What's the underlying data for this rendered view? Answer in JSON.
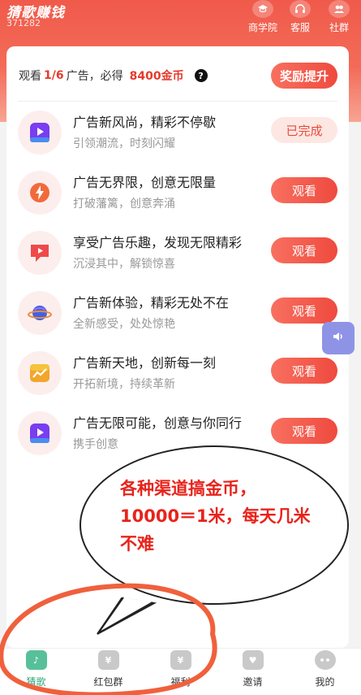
{
  "header": {
    "app_title": "猜歌赚钱",
    "app_id": "371282",
    "buttons": [
      {
        "label": "商学院",
        "icon": "graduation-cap-icon"
      },
      {
        "label": "客服",
        "icon": "headset-icon"
      },
      {
        "label": "社群",
        "icon": "group-icon"
      }
    ]
  },
  "summary": {
    "prefix": "观看",
    "progress": "1/6",
    "middle": "广告，必得",
    "coins": "8400金币",
    "help": "?",
    "reward_button": "奖励提升"
  },
  "tasks": [
    {
      "title": "广告新风尚，精彩不停歇",
      "subtitle": "引领潮流，时刻闪耀",
      "action": "已完成",
      "icon": "play-video-icon",
      "accent": "#7a3df0"
    },
    {
      "title": "广告无界限，创意无限量",
      "subtitle": "打破藩篱，创意奔涌",
      "action": "观看",
      "icon": "lightning-icon",
      "accent": "#f26a3c"
    },
    {
      "title": "享受广告乐趣，发现无限精彩",
      "subtitle": "沉浸其中，解锁惊喜",
      "action": "观看",
      "icon": "video-message-icon",
      "accent": "#ef4a4a"
    },
    {
      "title": "广告新体验，精彩无处不在",
      "subtitle": "全新感受，处处惊艳",
      "action": "观看",
      "icon": "planet-icon",
      "accent": "#3b63e6"
    },
    {
      "title": "广告新天地，创新每一刻",
      "subtitle": "开拓新境，持续革新",
      "action": "观看",
      "icon": "trend-chart-icon",
      "accent": "#f2a62b"
    },
    {
      "title": "广告无限可能，创意与你同行",
      "subtitle": "携手创意",
      "action": "观看",
      "icon": "play-video-icon",
      "accent": "#7a3df0"
    }
  ],
  "annotation": {
    "text": "各种渠道搞金币，10000＝1米，每天几米不难",
    "color": "#e8231b"
  },
  "tabs": [
    {
      "label": "猜歌",
      "icon": "music-note-icon",
      "active": true
    },
    {
      "label": "红包群",
      "icon": "red-envelope-icon",
      "active": false
    },
    {
      "label": "福利",
      "icon": "money-bag-icon",
      "active": false
    },
    {
      "label": "邀请",
      "icon": "invite-heart-icon",
      "active": false
    },
    {
      "label": "我的",
      "icon": "profile-face-icon",
      "active": false
    }
  ],
  "colors": {
    "brand": "#f05a4b",
    "action": "#ef4a3e",
    "active_tab": "#2fa67c"
  }
}
